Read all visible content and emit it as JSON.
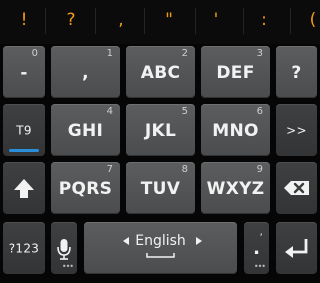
{
  "suggestions": [
    "!",
    "?",
    ",",
    "\"",
    "'",
    ":",
    "("
  ],
  "row1": [
    {
      "label": "-",
      "sub": "0"
    },
    {
      "label": ",",
      "sub": "1"
    },
    {
      "label": "ABC",
      "sub": "2"
    },
    {
      "label": "DEF",
      "sub": "3"
    },
    {
      "label": "?",
      "sub": ""
    }
  ],
  "row2": [
    {
      "label": "T9",
      "sub": ""
    },
    {
      "label": "GHI",
      "sub": "4"
    },
    {
      "label": "JKL",
      "sub": "5"
    },
    {
      "label": "MNO",
      "sub": "6"
    },
    {
      "label": ">>",
      "sub": ""
    }
  ],
  "row3": [
    {
      "label": "PQRS",
      "sub": "7"
    },
    {
      "label": "TUV",
      "sub": "8"
    },
    {
      "label": "WXYZ",
      "sub": "9"
    }
  ],
  "bottom": {
    "symbols_label": "?123",
    "language_label": "English",
    "period_label": ".",
    "period_sub": ","
  },
  "icons": {
    "shift": "shift-arrow-icon",
    "backspace": "backspace-icon",
    "mic": "microphone-icon",
    "enter": "enter-icon",
    "lang_left": "triangle-left-icon",
    "lang_right": "triangle-right-icon",
    "space": "space-bar-icon"
  },
  "colors": {
    "suggestion": "#f29a1a",
    "key": "#545658",
    "key_dark": "#3a3c3e",
    "background": "#060606",
    "t9_indicator": "#2a8ed8"
  }
}
